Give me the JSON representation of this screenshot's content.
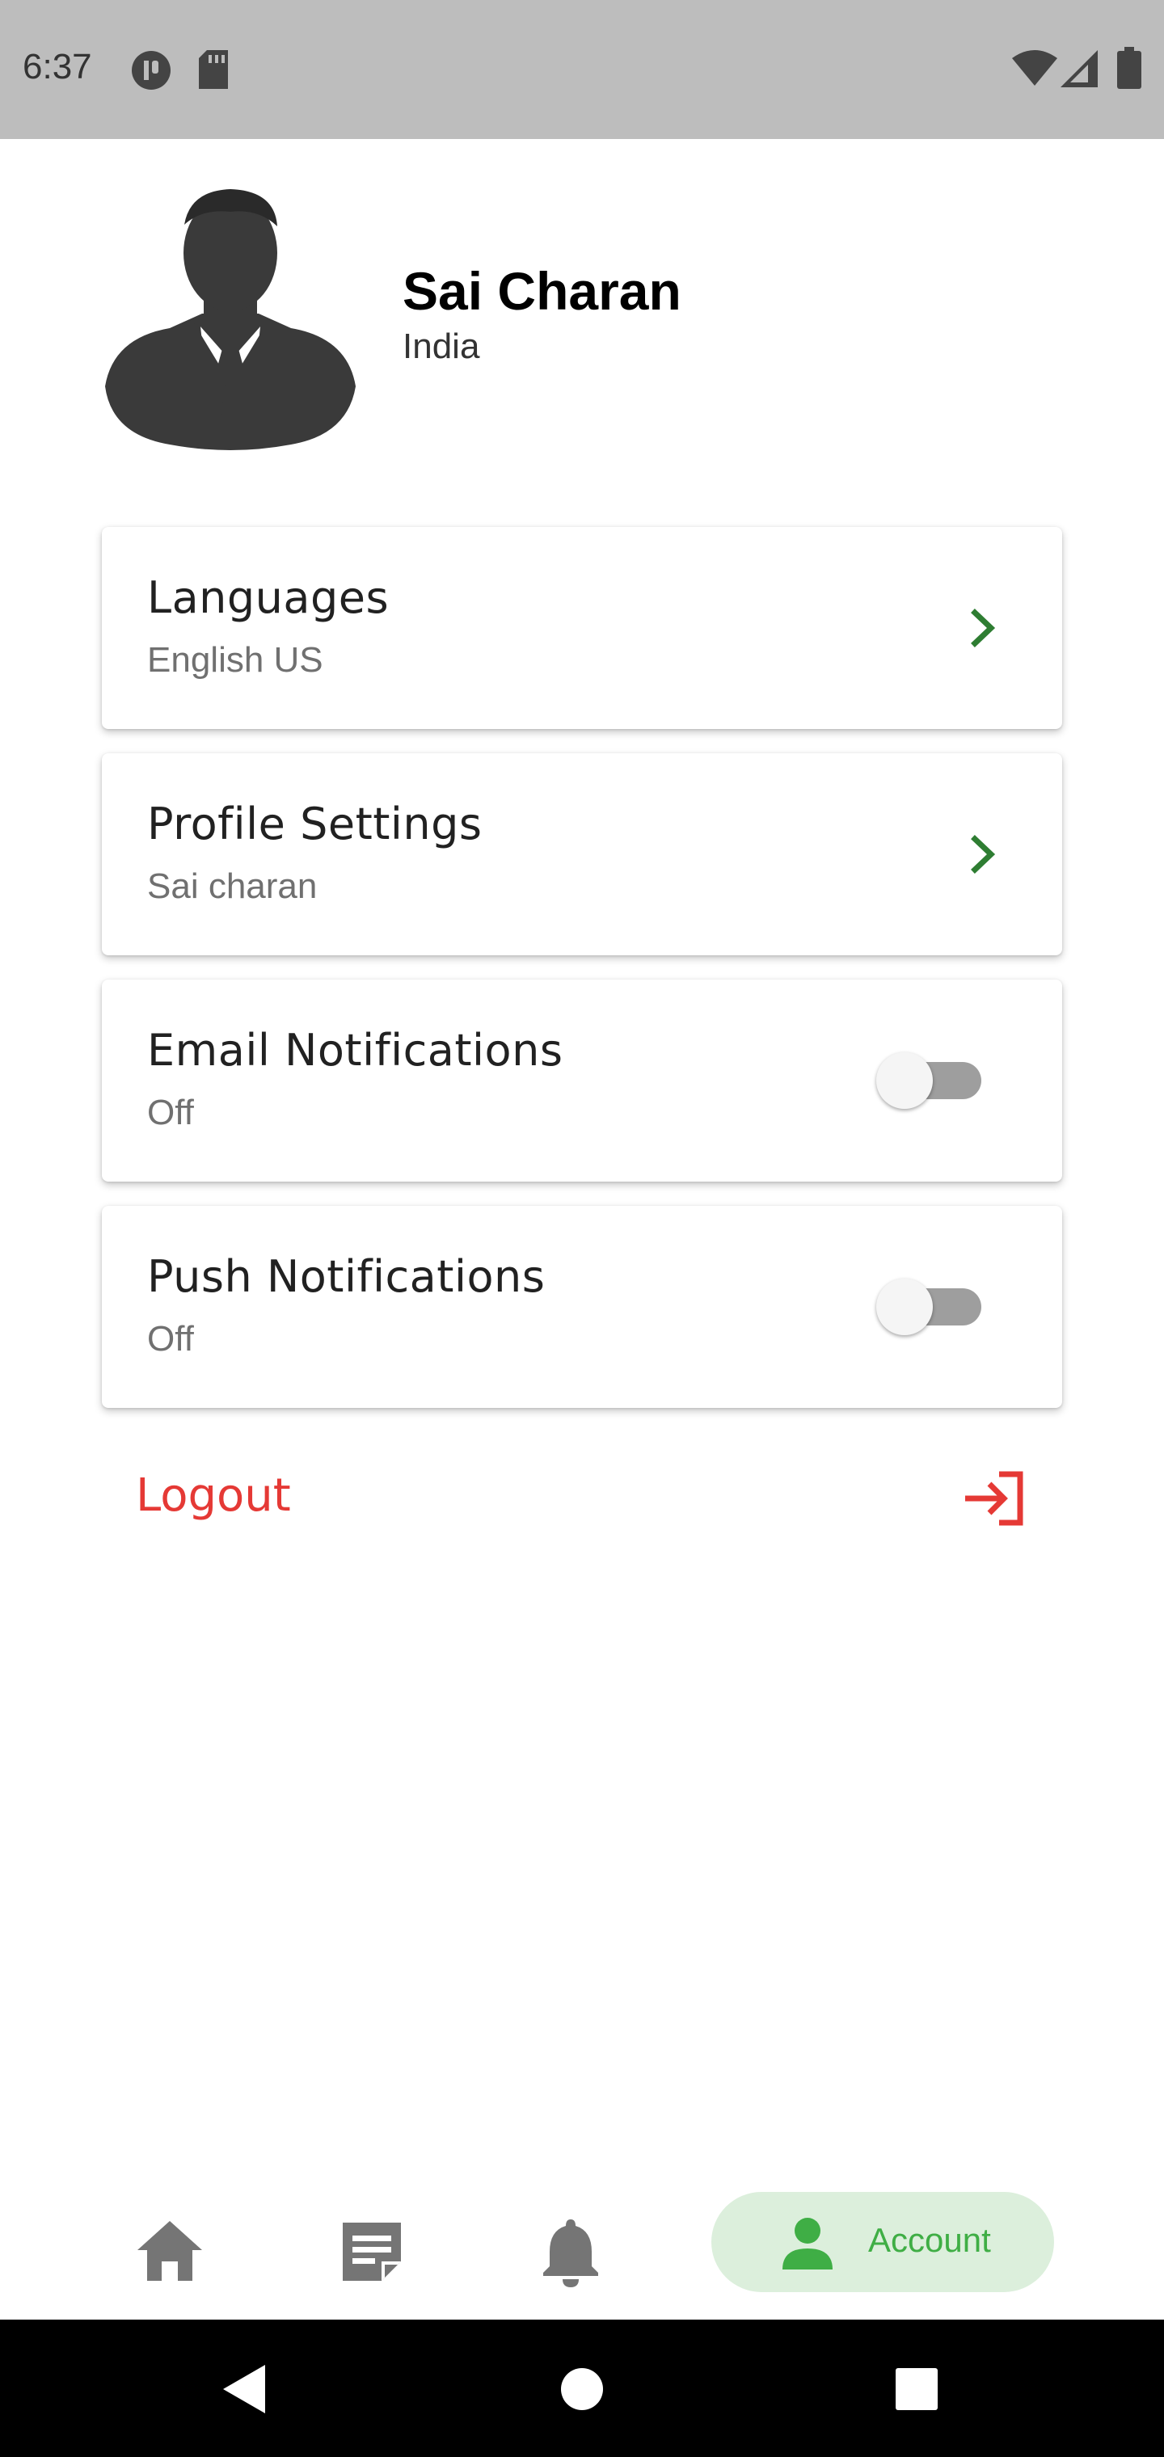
{
  "status_bar": {
    "time": "6:37",
    "left_icons": [
      "media-pause-icon",
      "sd-card-icon"
    ],
    "right_icons": [
      "wifi-icon",
      "signal-icon",
      "battery-icon"
    ]
  },
  "profile": {
    "name": "Sai Charan",
    "country": "India",
    "avatar_icon": "person-silhouette-icon"
  },
  "settings": [
    {
      "title": "Languages",
      "subtitle": "English US",
      "control": "chevron-right-icon"
    },
    {
      "title": "Profile Settings",
      "subtitle": "Sai charan",
      "control": "chevron-right-icon"
    },
    {
      "title": "Email Notifications",
      "subtitle": "Off",
      "control": "toggle",
      "enabled": false
    },
    {
      "title": "Push Notifications",
      "subtitle": "Off",
      "control": "toggle",
      "enabled": false
    }
  ],
  "logout": {
    "label": "Logout",
    "icon": "logout-icon"
  },
  "bottom_nav": {
    "items": [
      {
        "icon": "home-icon",
        "active": false
      },
      {
        "icon": "notes-icon",
        "active": false
      },
      {
        "icon": "bell-icon",
        "active": false
      },
      {
        "icon": "person-icon",
        "label": "Account",
        "active": true
      }
    ]
  },
  "system_nav": {
    "icons": [
      "back-icon",
      "home-circle-icon",
      "recents-icon"
    ]
  },
  "colors": {
    "accent": "#2e7d32",
    "active_nav_bg": "#dcefdc",
    "active_nav_fg": "#3fae45",
    "logout": "#e53935",
    "status_bar": "#bdbdbd"
  }
}
